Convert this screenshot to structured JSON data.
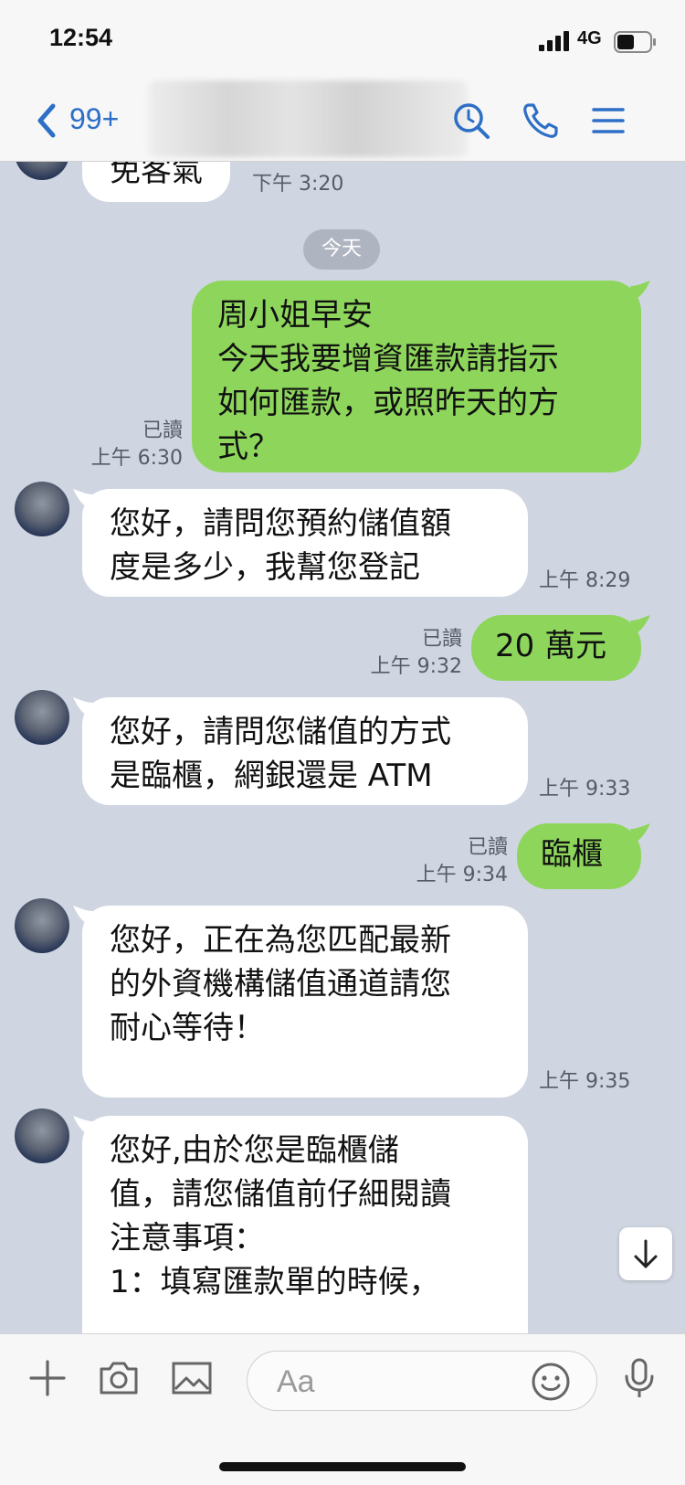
{
  "status_bar": {
    "time": "12:54",
    "network": "4G"
  },
  "nav": {
    "unread_badge": "99+"
  },
  "chat": {
    "messages": [
      {
        "id": "m0",
        "direction": "in",
        "text": "免客氣",
        "time": "下午 3:20"
      },
      {
        "id": "sep",
        "type": "date",
        "text": "今天"
      },
      {
        "id": "m1",
        "direction": "out",
        "lines": [
          "周小姐早安",
          "今天我要增資匯款請指示",
          "如何匯款，或照昨天的方",
          "式？"
        ],
        "read": "已讀",
        "time": "上午 6:30"
      },
      {
        "id": "m2",
        "direction": "in",
        "lines": [
          "您好，請問您預約儲值額",
          "度是多少，我幫您登記"
        ],
        "time": "上午 8:29"
      },
      {
        "id": "m3",
        "direction": "out",
        "text": "20 萬元",
        "read": "已讀",
        "time": "上午 9:32"
      },
      {
        "id": "m4",
        "direction": "in",
        "lines": [
          "您好，請問您儲值的方式",
          "是臨櫃，網銀還是 ATM"
        ],
        "time": "上午 9:33"
      },
      {
        "id": "m5",
        "direction": "out",
        "text": "臨櫃",
        "read": "已讀",
        "time": "上午 9:34"
      },
      {
        "id": "m6",
        "direction": "in",
        "lines": [
          "您好，正在為您匹配最新",
          "的外資機構儲值通道請您",
          "耐心等待！"
        ],
        "time": "上午 9:35"
      },
      {
        "id": "m7",
        "direction": "in",
        "lines": [
          "您好,由於您是臨櫃儲",
          "值，請您儲值前仔細閱讀",
          "注意事項：",
          "1：填寫匯款單的時候，"
        ]
      }
    ]
  },
  "input": {
    "placeholder": "Aa"
  },
  "colors": {
    "outgoing_bubble": "#8dd65b",
    "incoming_bubble": "#ffffff",
    "chat_bg": "#cfd6e1",
    "accent": "#2d6fc7"
  }
}
